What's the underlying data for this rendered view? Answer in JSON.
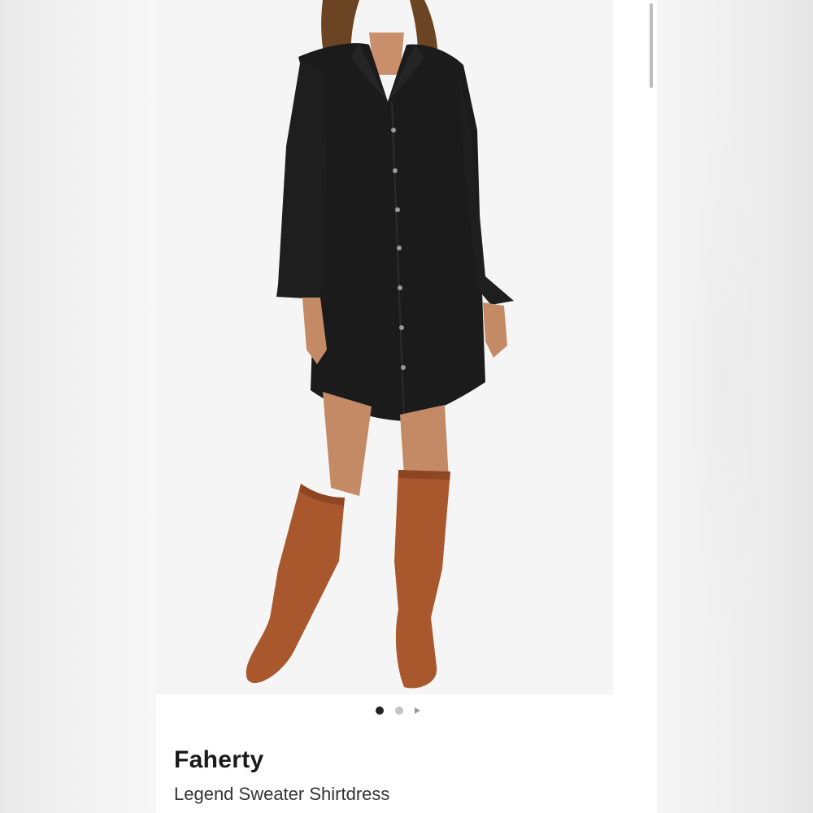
{
  "product": {
    "brand": "Faherty",
    "name": "Legend Sweater Shirtdress"
  },
  "gallery": {
    "image_count": 2,
    "active_index": 0,
    "image_icon": "product-photo-woman-black-shirtdress-brown-boots"
  },
  "colors": {
    "dress": "#1b1b1b",
    "boots": "#a8582c",
    "background": "#f5f5f5",
    "active_dot": "#222222",
    "inactive_dot": "#c4c4c4"
  },
  "icons": {
    "next": "chevron-right-icon"
  }
}
